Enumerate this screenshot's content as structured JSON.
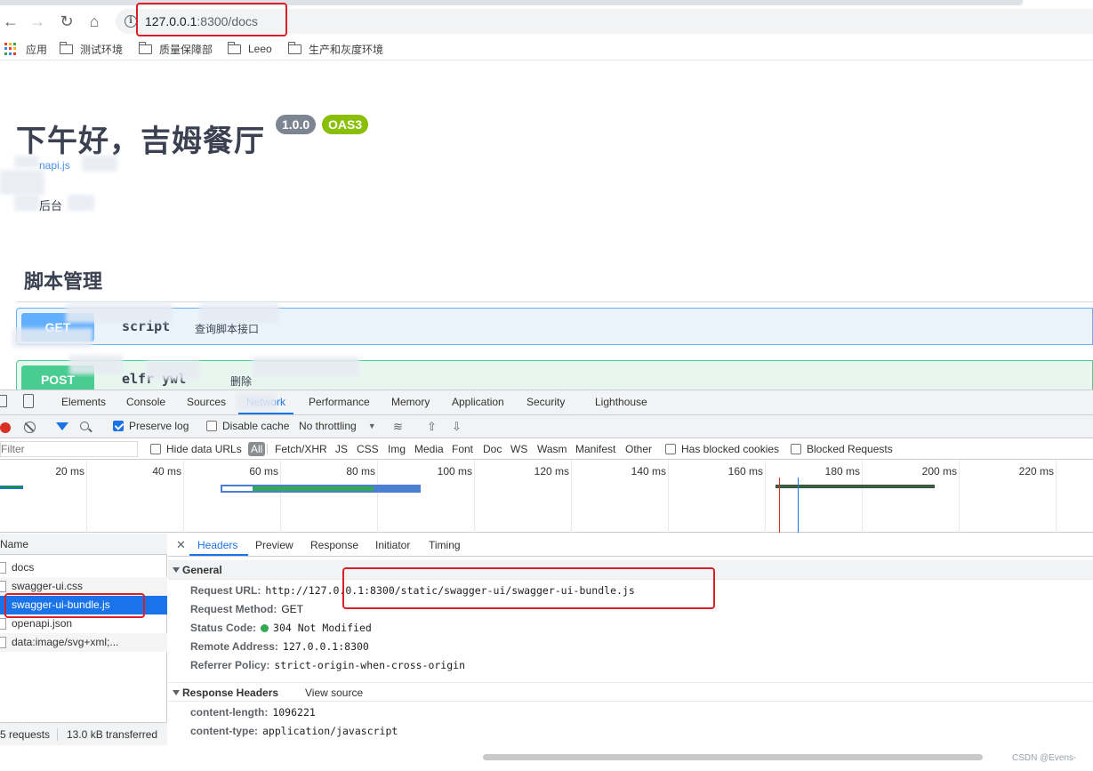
{
  "browser": {
    "url_host": "127.0.0.1",
    "url_rest": ":8300/docs",
    "bookmarks": [
      {
        "label": "应用",
        "icon": "apps-grid-icon"
      },
      {
        "label": "测试环境",
        "icon": "folder-icon"
      },
      {
        "label": "质量保障部",
        "icon": "folder-icon"
      },
      {
        "label": "Leeo",
        "icon": "folder-icon"
      },
      {
        "label": "生产和灰度环境",
        "icon": "folder-icon"
      }
    ]
  },
  "swagger": {
    "title": "下午好，吉姆餐厅",
    "version": "1.0.0",
    "oas": "OAS3",
    "link_fragment": "napi.js",
    "desc_fragment": "后台",
    "section": "脚本管理",
    "operations": [
      {
        "method": "GET",
        "path": "script",
        "summary": "查询脚本接口"
      },
      {
        "method": "POST",
        "path": "elfr ywl",
        "summary": "删除"
      }
    ]
  },
  "devtools": {
    "tabs": [
      "Elements",
      "Console",
      "Sources",
      "Network",
      "Performance",
      "Memory",
      "Application",
      "Security",
      "Lighthouse"
    ],
    "active_tab": "Network",
    "toolbar": {
      "preserve_log": "Preserve log",
      "disable_cache": "Disable cache",
      "throttling": "No throttling"
    },
    "filter": {
      "placeholder": "Filter",
      "hide_data_urls": "Hide data URLs",
      "all": "All",
      "types": [
        "Fetch/XHR",
        "JS",
        "CSS",
        "Img",
        "Media",
        "Font",
        "Doc",
        "WS",
        "Wasm",
        "Manifest",
        "Other"
      ],
      "has_blocked_cookies": "Has blocked cookies",
      "blocked_requests": "Blocked Requests"
    },
    "timeline_ticks": [
      "20 ms",
      "40 ms",
      "60 ms",
      "80 ms",
      "100 ms",
      "120 ms",
      "140 ms",
      "160 ms",
      "180 ms",
      "200 ms",
      "220 ms"
    ],
    "request_list": {
      "header": "Name",
      "rows": [
        "docs",
        "swagger-ui.css",
        "swagger-ui-bundle.js",
        "openapi.json",
        "data:image/svg+xml;..."
      ],
      "selected": "swagger-ui-bundle.js",
      "footer_requests": "5 requests",
      "footer_transferred": "13.0 kB transferred"
    },
    "details": {
      "tabs": [
        "Headers",
        "Preview",
        "Response",
        "Initiator",
        "Timing"
      ],
      "active": "Headers",
      "general_title": "General",
      "general": [
        {
          "key": "Request URL:",
          "value": "http://127.0.0.1:8300/static/swagger-ui/swagger-ui-bundle.js"
        },
        {
          "key": "Request Method:",
          "value": "GET"
        },
        {
          "key": "Status Code:",
          "value": "304 Not Modified"
        },
        {
          "key": "Remote Address:",
          "value": "127.0.0.1:8300"
        },
        {
          "key": "Referrer Policy:",
          "value": "strict-origin-when-cross-origin"
        }
      ],
      "response_title": "Response Headers",
      "view_source": "View source",
      "response": [
        {
          "key": "content-length:",
          "value": "1096221"
        },
        {
          "key": "content-type:",
          "value": "application/javascript"
        }
      ]
    }
  },
  "watermark": "CSDN @Evens-",
  "colors": {
    "get": "#61affe",
    "post": "#49cc90",
    "devtools_accent": "#1a73e8",
    "highlight_box": "#d9202a"
  }
}
